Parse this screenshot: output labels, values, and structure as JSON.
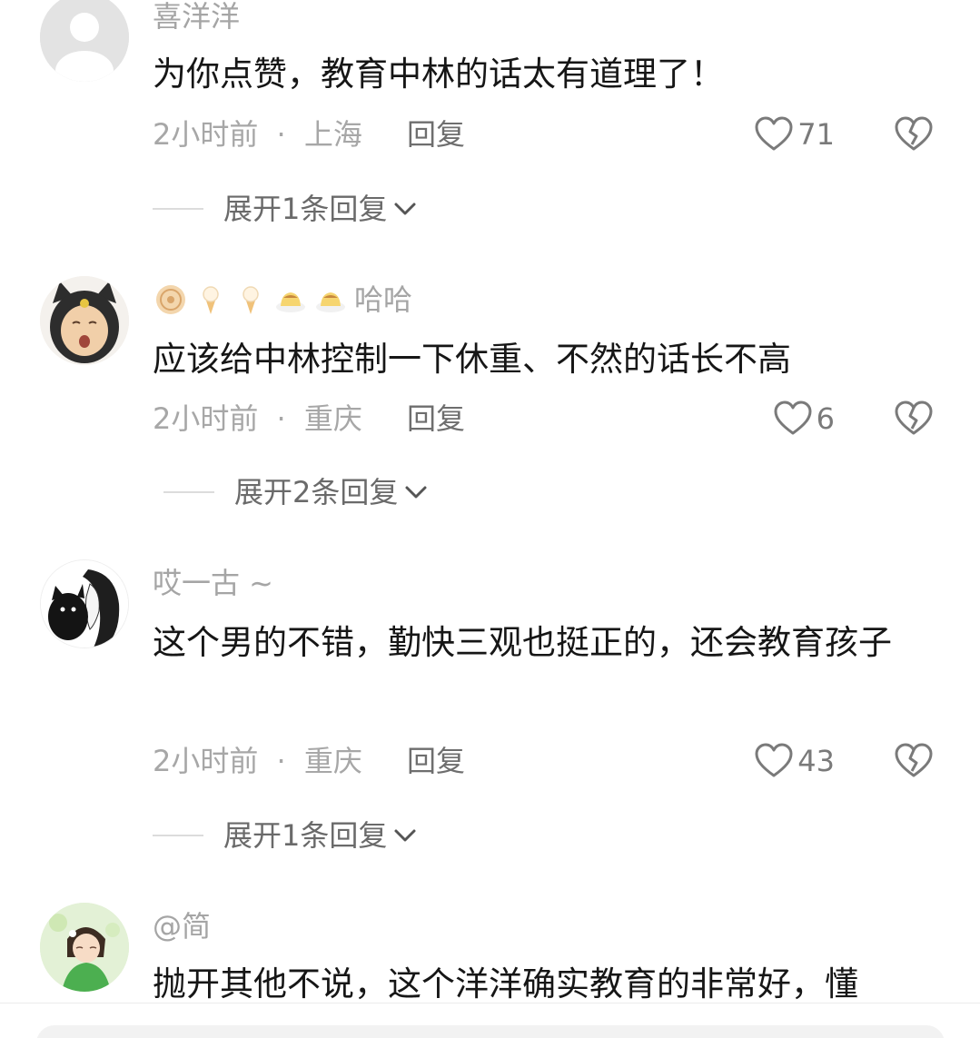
{
  "comments": [
    {
      "username": "喜洋洋",
      "text": "为你点赞，教育中林的话太有道理了！",
      "time": "2小时前",
      "location": "上海",
      "reply_label": "回复",
      "likes": "71",
      "expand_label": "展开1条回复"
    },
    {
      "username": "哈哈",
      "badges": [
        "mooncake-icon",
        "ice-cream-icon",
        "ice-cream-icon",
        "pudding-icon",
        "pudding-icon"
      ],
      "text": "应该给中林控制一下休重、不然的话长不高",
      "time": "2小时前",
      "location": "重庆",
      "reply_label": "回复",
      "likes": "6",
      "expand_label": "展开2条回复"
    },
    {
      "username": "哎一古 ~",
      "text": "这个男的不错，勤快三观也挺正的，还会教育孩子",
      "time": "2小时前",
      "location": "重庆",
      "reply_label": "回复",
      "likes": "43",
      "expand_label": "展开1条回复"
    },
    {
      "username": "@简",
      "text": "抛开其他不说，这个洋洋确实教育的非常好，懂"
    }
  ],
  "meta_separator": "·",
  "colors": {
    "text": "#161616",
    "muted": "#a7a7a7",
    "reply": "#6e6e6e",
    "icon": "#7a7a7a"
  }
}
